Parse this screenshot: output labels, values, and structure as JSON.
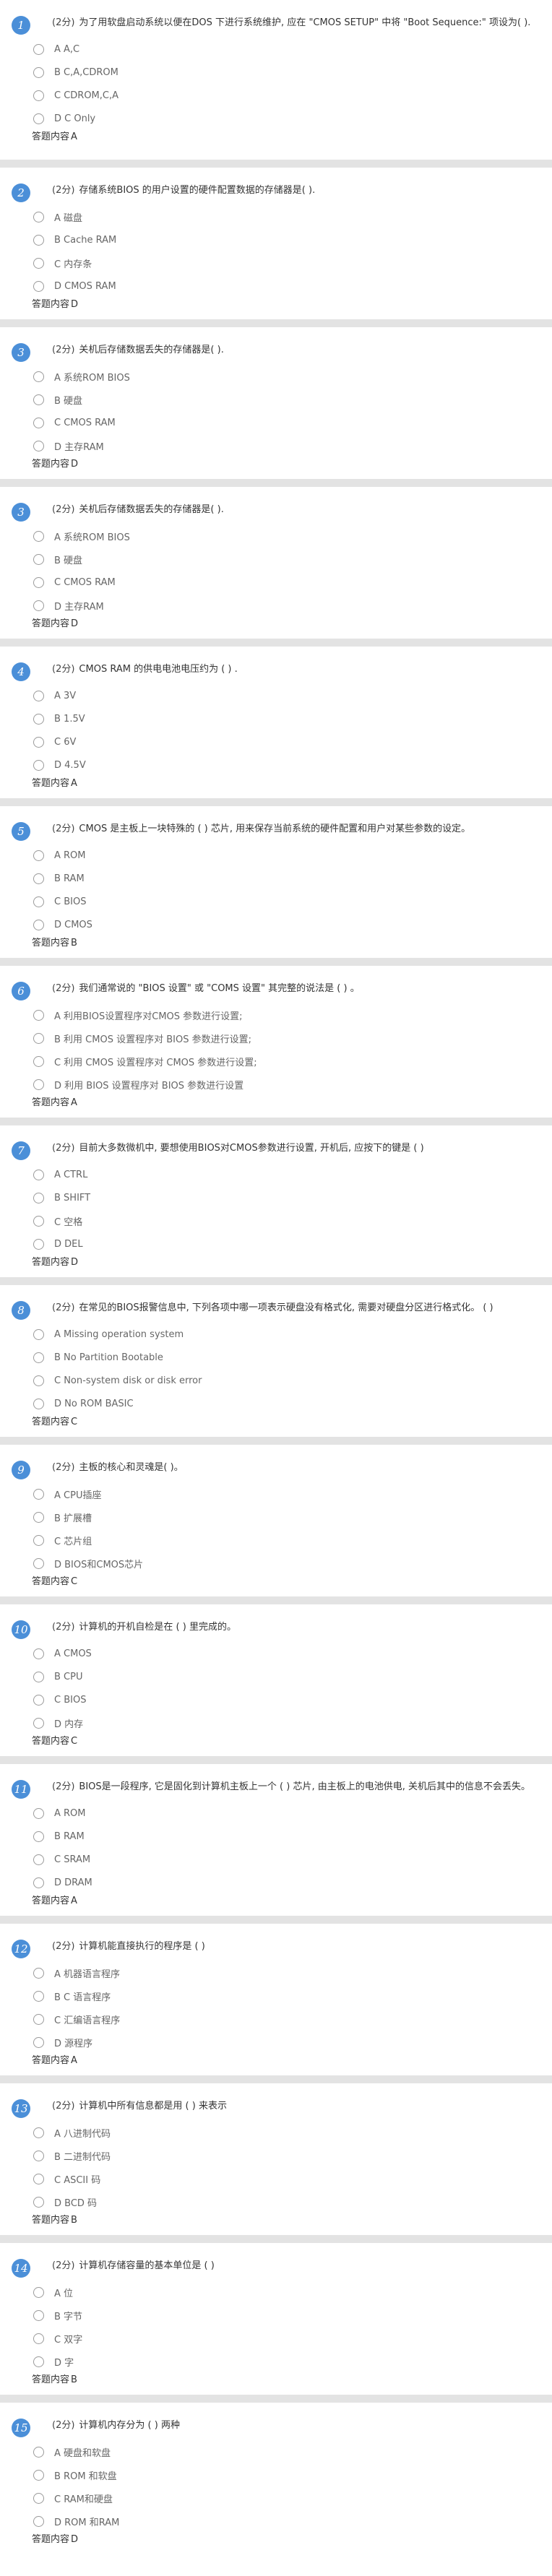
{
  "answer_label": "答题内容",
  "questions": [
    {
      "number": "1",
      "score": "(2分)",
      "text": "为了用软盘启动系统以便在DOS 下进行系统维护, 应在 \"CMOS SETUP\" 中将 \"Boot Sequence:\" 项设为( ).",
      "options": [
        "A A,C",
        "B C,A,CDROM",
        "C CDROM,C,A",
        "D C Only"
      ],
      "answer": "A"
    },
    {
      "number": "2",
      "score": "(2分)",
      "text": "存储系统BIOS 的用户设置的硬件配置数据的存储器是( ).",
      "options": [
        "A 磁盘",
        "B Cache RAM",
        "C 内存条",
        "D CMOS RAM"
      ],
      "answer": "D"
    },
    {
      "number": "3",
      "score": "(2分)",
      "text": "关机后存储数据丢失的存储器是( ).",
      "options": [
        "A 系统ROM BIOS",
        "B 硬盘",
        "C CMOS RAM",
        "D 主存RAM"
      ],
      "answer": "D"
    },
    {
      "number": "3",
      "score": "(2分)",
      "text": "关机后存储数据丢失的存储器是( ).",
      "options": [
        "A 系统ROM BIOS",
        "B 硬盘",
        "C CMOS RAM",
        "D 主存RAM"
      ],
      "answer": "D"
    },
    {
      "number": "4",
      "score": "(2分)",
      "text": "CMOS RAM 的供电电池电压约为 ( ) .",
      "options": [
        "A 3V",
        "B 1.5V",
        "C 6V",
        "D 4.5V"
      ],
      "answer": "A"
    },
    {
      "number": "5",
      "score": "(2分)",
      "text": "CMOS 是主板上一块特殊的 ( ) 芯片, 用来保存当前系统的硬件配置和用户对某些参数的设定。",
      "options": [
        "A ROM",
        "B RAM",
        "C BIOS",
        "D CMOS"
      ],
      "answer": "B"
    },
    {
      "number": "6",
      "score": "(2分)",
      "text": "我们通常说的 \"BIOS 设置\" 或 \"COMS 设置\" 其完整的说法是 ( ) 。",
      "options": [
        "A 利用BIOS设置程序对CMOS 参数进行设置;",
        "B 利用 CMOS 设置程序对 BIOS 参数进行设置;",
        "C 利用 CMOS 设置程序对 CMOS 参数进行设置;",
        "D 利用 BIOS 设置程序对 BIOS 参数进行设置"
      ],
      "answer": "A"
    },
    {
      "number": "7",
      "score": "(2分)",
      "text": "目前大多数微机中, 要想使用BIOS对CMOS参数进行设置, 开机后, 应按下的键是 ( )",
      "options": [
        "A CTRL",
        "B SHIFT",
        "C 空格",
        "D DEL"
      ],
      "answer": "D"
    },
    {
      "number": "8",
      "score": "(2分)",
      "text": "在常见的BIOS报警信息中, 下列各项中哪一项表示硬盘没有格式化, 需要对硬盘分区进行格式化。 ( )",
      "options": [
        "A Missing operation system",
        "B No Partition Bootable",
        "C Non-system disk or disk error",
        "D No ROM BASIC"
      ],
      "answer": "C"
    },
    {
      "number": "9",
      "score": "(2分)",
      "text": "主板的核心和灵魂是( )。",
      "options": [
        "A CPU插座",
        "B 扩展槽",
        "C 芯片组",
        "D BIOS和CMOS芯片"
      ],
      "answer": "C"
    },
    {
      "number": "10",
      "score": "(2分)",
      "text": "计算机的开机自检是在 ( ) 里完成的。",
      "options": [
        "A CMOS",
        "B CPU",
        "C BIOS",
        "D 内存"
      ],
      "answer": "C"
    },
    {
      "number": "11",
      "score": "(2分)",
      "text": "BIOS是一段程序, 它是固化到计算机主板上一个 ( ) 芯片, 由主板上的电池供电, 关机后其中的信息不会丢失。",
      "options": [
        "A ROM",
        "B RAM",
        "C SRAM",
        "D DRAM"
      ],
      "answer": "A"
    },
    {
      "number": "12",
      "score": "(2分)",
      "text": "计算机能直接执行的程序是 ( )",
      "options": [
        "A 机器语言程序",
        "B C 语言程序",
        "C 汇编语言程序",
        "D 源程序"
      ],
      "answer": "A"
    },
    {
      "number": "13",
      "score": "(2分)",
      "text": "计算机中所有信息都是用 ( ) 来表示",
      "options": [
        "A 八进制代码",
        "B 二进制代码",
        "C ASCII 码",
        "D BCD 码"
      ],
      "answer": "B"
    },
    {
      "number": "14",
      "score": "(2分)",
      "text": "计算机存储容量的基本单位是 ( )",
      "options": [
        "A 位",
        "B 字节",
        "C 双字",
        "D 字"
      ],
      "answer": "B"
    },
    {
      "number": "15",
      "score": "(2分)",
      "text": "计算机内存分为 ( ) 两种",
      "options": [
        "A 硬盘和软盘",
        "B ROM 和软盘",
        "C RAM和硬盘",
        "D ROM 和RAM"
      ],
      "answer": "D"
    }
  ]
}
